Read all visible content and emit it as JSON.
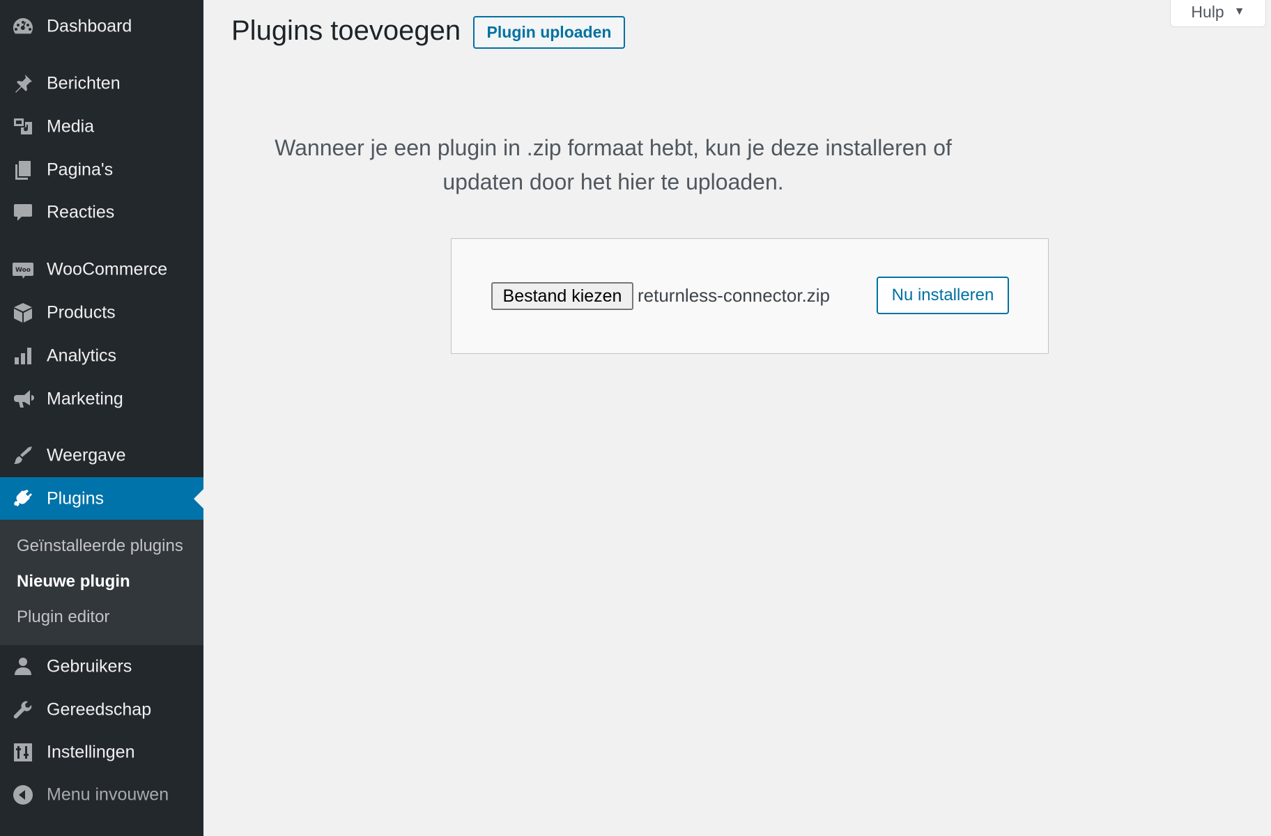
{
  "sidebar": {
    "items": [
      {
        "label": "Dashboard",
        "icon": "dashboard-icon"
      },
      {
        "label": "Berichten",
        "icon": "pushpin-icon"
      },
      {
        "label": "Media",
        "icon": "media-icon"
      },
      {
        "label": "Pagina's",
        "icon": "pages-icon"
      },
      {
        "label": "Reacties",
        "icon": "comment-icon"
      },
      {
        "label": "WooCommerce",
        "icon": "woo-icon"
      },
      {
        "label": "Products",
        "icon": "archive-box-icon"
      },
      {
        "label": "Analytics",
        "icon": "bar-chart-icon"
      },
      {
        "label": "Marketing",
        "icon": "megaphone-icon"
      },
      {
        "label": "Weergave",
        "icon": "paintbrush-icon"
      },
      {
        "label": "Plugins",
        "icon": "plugin-icon"
      },
      {
        "label": "Gebruikers",
        "icon": "user-icon"
      },
      {
        "label": "Gereedschap",
        "icon": "wrench-icon"
      },
      {
        "label": "Instellingen",
        "icon": "settings-sliders-icon"
      },
      {
        "label": "Menu invouwen",
        "icon": "collapse-arrow-icon"
      }
    ],
    "active": "Plugins",
    "submenu": [
      {
        "label": "Geïnstalleerde plugins"
      },
      {
        "label": "Nieuwe plugin"
      },
      {
        "label": "Plugin editor"
      }
    ],
    "submenu_current": "Nieuwe plugin"
  },
  "header": {
    "title": "Plugins toevoegen",
    "upload_button": "Plugin uploaden",
    "help_label": "Hulp",
    "help_caret": "▼"
  },
  "upload": {
    "help_text": "Wanneer je een plugin in .zip formaat hebt, kun je deze installeren of updaten door het hier te uploaden.",
    "choose_file_label": "Bestand kiezen",
    "file_name": "returnless-connector.zip",
    "install_button": "Nu installeren"
  },
  "colors": {
    "sidebar_bg": "#23282d",
    "submenu_bg": "#32373c",
    "active_bg": "#0073aa",
    "accent": "#0071a1",
    "page_bg": "#f1f1f1"
  }
}
